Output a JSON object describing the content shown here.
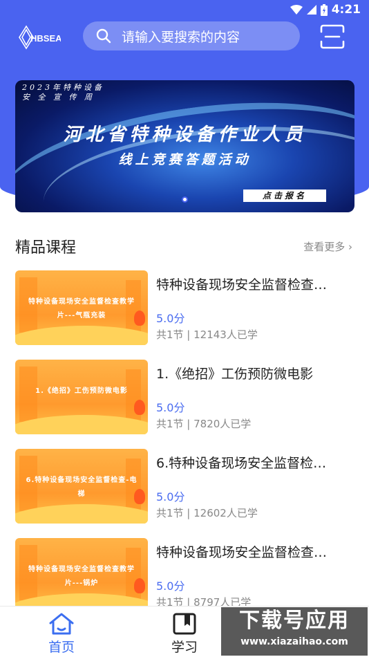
{
  "status_bar": {
    "time": "4:21"
  },
  "header": {
    "logo_text": "HBSEA",
    "search_placeholder": "请输入要搜索的内容"
  },
  "banner": {
    "tag": "2023年特种设备\n安 全 宣 传 周",
    "title": "河北省特种设备作业人员",
    "subtitle": "线上竞赛答题活动",
    "cta": "点击报名"
  },
  "section": {
    "title": "精品课程",
    "more": "查看更多 ›"
  },
  "courses": [
    {
      "thumb": "特种设备现场安全监督检查教学片---气瓶充装",
      "title": "特种设备现场安全监督检查…",
      "rating": "5.0分",
      "meta": "共1节 | 12143人已学"
    },
    {
      "thumb": "1.《绝招》工伤预防微电影",
      "title": "1.《绝招》工伤预防微电影",
      "rating": "5.0分",
      "meta": "共1节 | 7820人已学"
    },
    {
      "thumb": "6.特种设备现场安全监督检查-电梯",
      "title": "6.特种设备现场安全监督检…",
      "rating": "5.0分",
      "meta": "共1节 | 12602人已学"
    },
    {
      "thumb": "特种设备现场安全监督检查教学片---锅炉",
      "title": "特种设备现场安全监督检查…",
      "rating": "5.0分",
      "meta": "共1节 | 8797人已学"
    }
  ],
  "nav": {
    "home": "首页",
    "study": "学习"
  },
  "watermark": {
    "main": "下载号应用",
    "url": "www.xiazaihao.com"
  },
  "colors": {
    "primary": "#4a63f0",
    "rating": "#4a6cf0"
  }
}
